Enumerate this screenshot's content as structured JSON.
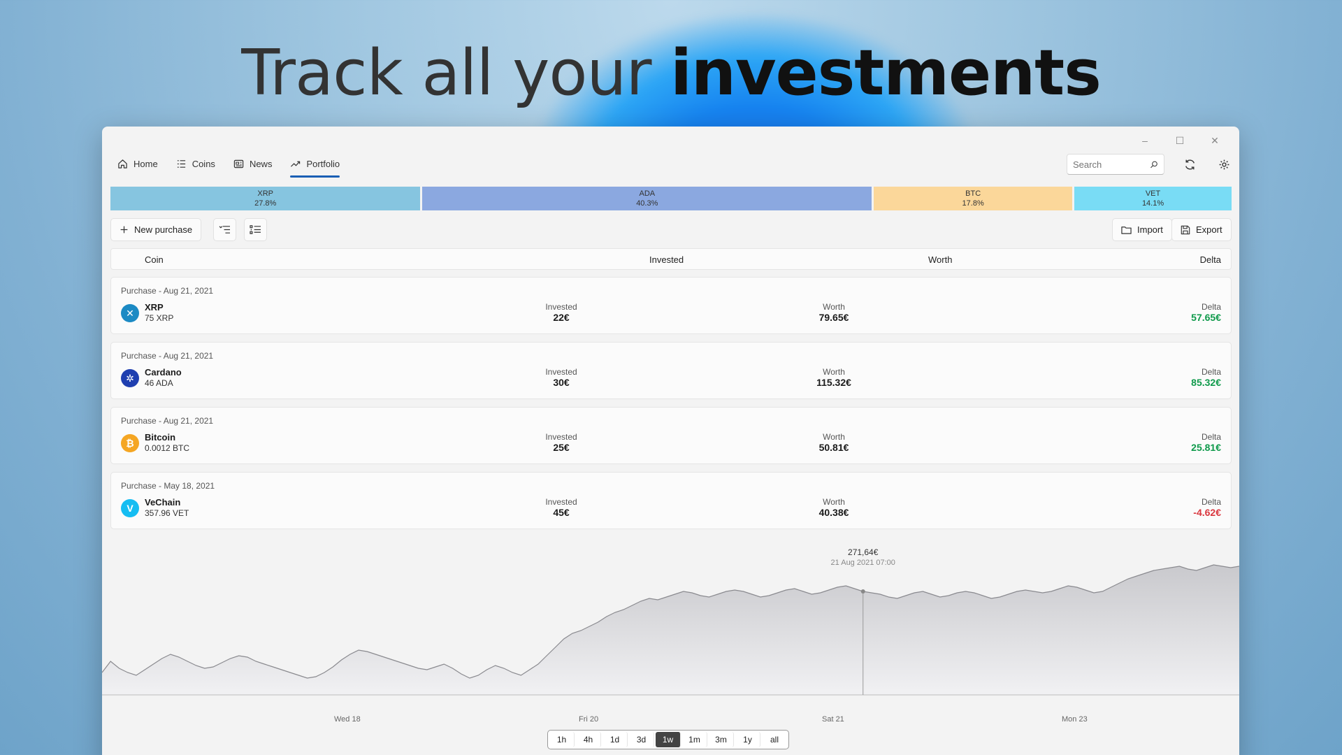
{
  "headline": {
    "regular": "Track all your ",
    "bold": "investments"
  },
  "window": {
    "minimize": "–",
    "maximize": "☐",
    "close": "✕"
  },
  "nav": [
    {
      "label": "Home",
      "icon": "home-icon"
    },
    {
      "label": "Coins",
      "icon": "list-icon"
    },
    {
      "label": "News",
      "icon": "news-icon"
    },
    {
      "label": "Portfolio",
      "icon": "trend-icon",
      "active": true
    }
  ],
  "search": {
    "placeholder": "Search",
    "value": ""
  },
  "allocation": [
    {
      "symbol": "XRP",
      "percent": "27.8%",
      "color": "#86c5e0"
    },
    {
      "symbol": "ADA",
      "percent": "40.3%",
      "color": "#8ba8e0"
    },
    {
      "symbol": "BTC",
      "percent": "17.8%",
      "color": "#fbd79a"
    },
    {
      "symbol": "VET",
      "percent": "14.1%",
      "color": "#79dcf5"
    }
  ],
  "toolbar": {
    "new_purchase": "New purchase",
    "import": "Import",
    "export": "Export"
  },
  "columns": {
    "coin": "Coin",
    "invested": "Invested",
    "worth": "Worth",
    "delta": "Delta"
  },
  "purchases": [
    {
      "date": "Purchase - Aug 21, 2021",
      "name": "XRP",
      "amount": "75 XRP",
      "invested_label": "Invested",
      "invested": "22€",
      "worth_label": "Worth",
      "worth": "79.65€",
      "delta_label": "Delta",
      "delta": "57.65€",
      "color": "#1c8ac4",
      "icon": "xrp-icon",
      "glyph": "✕",
      "positive": true
    },
    {
      "date": "Purchase - Aug 21, 2021",
      "name": "Cardano",
      "amount": "46 ADA",
      "invested_label": "Invested",
      "invested": "30€",
      "worth_label": "Worth",
      "worth": "115.32€",
      "delta_label": "Delta",
      "delta": "85.32€",
      "color": "#1f3fb0",
      "icon": "cardano-icon",
      "glyph": "✲",
      "positive": true
    },
    {
      "date": "Purchase - Aug 21, 2021",
      "name": "Bitcoin",
      "amount": "0.0012 BTC",
      "invested_label": "Invested",
      "invested": "25€",
      "worth_label": "Worth",
      "worth": "50.81€",
      "delta_label": "Delta",
      "delta": "25.81€",
      "color": "#f5a623",
      "icon": "bitcoin-icon",
      "glyph": "₿",
      "positive": true
    },
    {
      "date": "Purchase - May 18, 2021",
      "name": "VeChain",
      "amount": "357.96 VET",
      "invested_label": "Invested",
      "invested": "45€",
      "worth_label": "Worth",
      "worth": "40.38€",
      "delta_label": "Delta",
      "delta": "-4.62€",
      "color": "#15bdf2",
      "icon": "vechain-icon",
      "glyph": "V",
      "positive": false
    }
  ],
  "colors": {
    "positive": "#0f9a4b",
    "negative": "#d9363e",
    "accent": "#1a5fb4"
  },
  "chart_data": {
    "type": "area",
    "x_ticks": [
      "Wed 18",
      "Fri 20",
      "Sat 21",
      "Mon 23"
    ],
    "tooltip": {
      "value": "271,64€",
      "date": "21 Aug 2021 07:00"
    },
    "y": [
      186,
      194,
      189,
      186,
      184,
      188,
      192,
      196,
      199,
      197,
      194,
      191,
      189,
      190,
      193,
      196,
      198,
      197,
      194,
      192,
      190,
      188,
      186,
      184,
      182,
      183,
      186,
      190,
      195,
      199,
      202,
      201,
      199,
      197,
      195,
      193,
      191,
      189,
      188,
      190,
      192,
      189,
      185,
      182,
      184,
      188,
      191,
      189,
      186,
      184,
      188,
      192,
      198,
      204,
      210,
      214,
      216,
      219,
      222,
      226,
      229,
      231,
      234,
      237,
      239,
      238,
      240,
      242,
      244,
      243,
      241,
      240,
      242,
      244,
      245,
      244,
      242,
      240,
      241,
      243,
      245,
      246,
      244,
      242,
      243,
      245,
      247,
      248,
      246,
      244,
      243,
      242,
      240,
      239,
      241,
      243,
      244,
      242,
      240,
      241,
      243,
      244,
      243,
      241,
      239,
      240,
      242,
      244,
      245,
      244,
      243,
      244,
      246,
      248,
      247,
      245,
      243,
      244,
      247,
      250,
      253,
      255,
      257,
      259,
      260,
      261,
      262,
      260,
      259,
      261,
      263,
      262,
      261,
      262
    ],
    "ylim": [
      170,
      275
    ],
    "highlight_index": 89
  },
  "ranges": [
    {
      "label": "1h"
    },
    {
      "label": "4h"
    },
    {
      "label": "1d"
    },
    {
      "label": "3d"
    },
    {
      "label": "1w",
      "active": true
    },
    {
      "label": "1m"
    },
    {
      "label": "3m"
    },
    {
      "label": "1y"
    },
    {
      "label": "all"
    }
  ]
}
